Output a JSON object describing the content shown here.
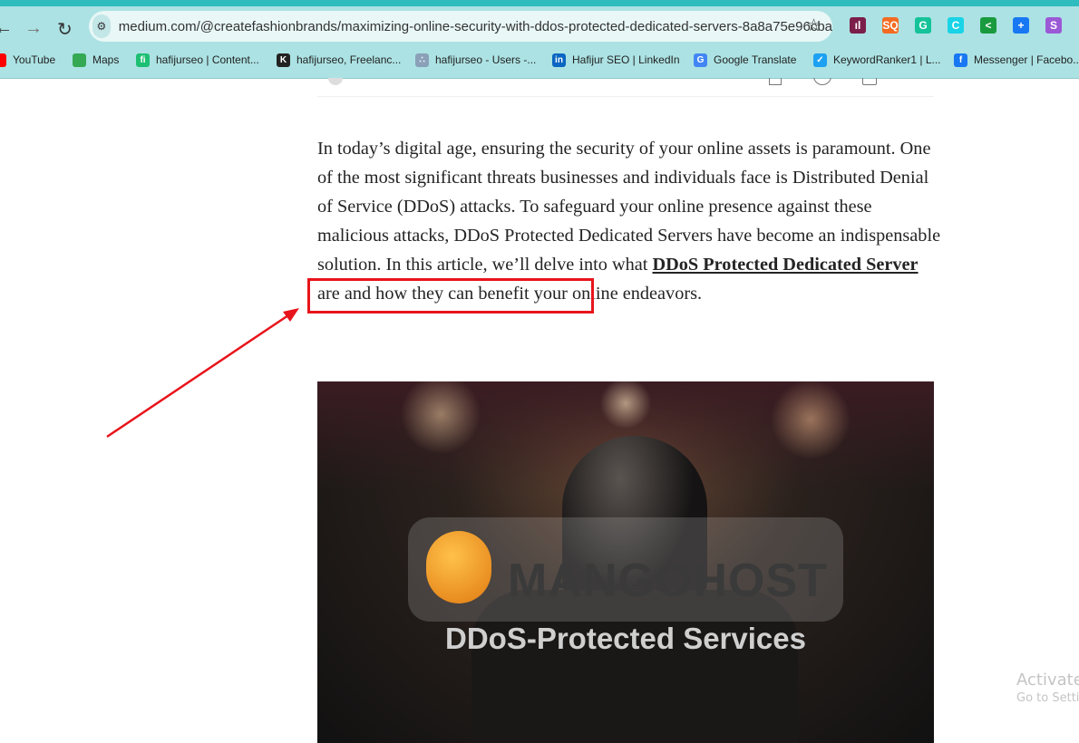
{
  "browser": {
    "url": "medium.com/@createfashionbrands/maximizing-online-security-with-ddos-protected-dedicated-servers-8a8a75e96cba",
    "extensions": [
      {
        "name": "analytics-extension",
        "color": "#7b1f4a",
        "glyph": "ıl"
      },
      {
        "name": "sq-extension",
        "color": "#f36b21",
        "glyph": "SQ"
      },
      {
        "name": "grammarly-extension",
        "color": "#15c39a",
        "glyph": "G"
      },
      {
        "name": "c-extension",
        "color": "#19d3e6",
        "glyph": "C"
      },
      {
        "name": "share-extension",
        "color": "#1a9a3f",
        "glyph": "<"
      },
      {
        "name": "plus-extension",
        "color": "#1877f2",
        "glyph": "+"
      },
      {
        "name": "s-extension",
        "color": "#9b59d6",
        "glyph": "S"
      }
    ],
    "bookmarks": [
      {
        "label": "YouTube",
        "icon": "youtube-icon",
        "color": "#ff0000",
        "glyph": ""
      },
      {
        "label": "Maps",
        "icon": "maps-icon",
        "color": "#34a853",
        "glyph": ""
      },
      {
        "label": "hafijurseo | Content...",
        "icon": "fiverr-icon",
        "color": "#1dbf73",
        "glyph": "fi"
      },
      {
        "label": "hafijurseo, Freelanc...",
        "icon": "k-icon",
        "color": "#222222",
        "glyph": "K"
      },
      {
        "label": "hafijurseo - Users -...",
        "icon": "network-icon",
        "color": "#8aa0b8",
        "glyph": "∴"
      },
      {
        "label": "Hafijur SEO | LinkedIn",
        "icon": "linkedin-icon",
        "color": "#0a66c2",
        "glyph": "in"
      },
      {
        "label": "Google Translate",
        "icon": "google-translate-icon",
        "color": "#4285f4",
        "glyph": "G"
      },
      {
        "label": "KeywordRanker1 | L...",
        "icon": "keywordranker-icon",
        "color": "#1da1f2",
        "glyph": "✓"
      },
      {
        "label": "Messenger | Facebo...",
        "icon": "facebook-icon",
        "color": "#1877f2",
        "glyph": "f"
      }
    ]
  },
  "article": {
    "text_before": "In today’s digital age, ensuring the security of your online assets is paramount. One of the most significant threats businesses and individuals face is Distributed Denial of Service (DDoS) attacks. To safeguard your online presence against these malicious attacks, DDoS Protected Dedicated Servers have become an indispensable solution. In this article, we’ll delve into what ",
    "link_text": "DDoS Protected Dedicated Server",
    "text_after": " are and how they can benefit your online endeavors.",
    "image": {
      "brand": "MANGOHOST",
      "tagline": "DDoS-Protected Services"
    }
  },
  "annotation": {
    "color": "#e8141b"
  },
  "watermark": {
    "title": "Activate",
    "subtitle": "Go to Setti"
  }
}
